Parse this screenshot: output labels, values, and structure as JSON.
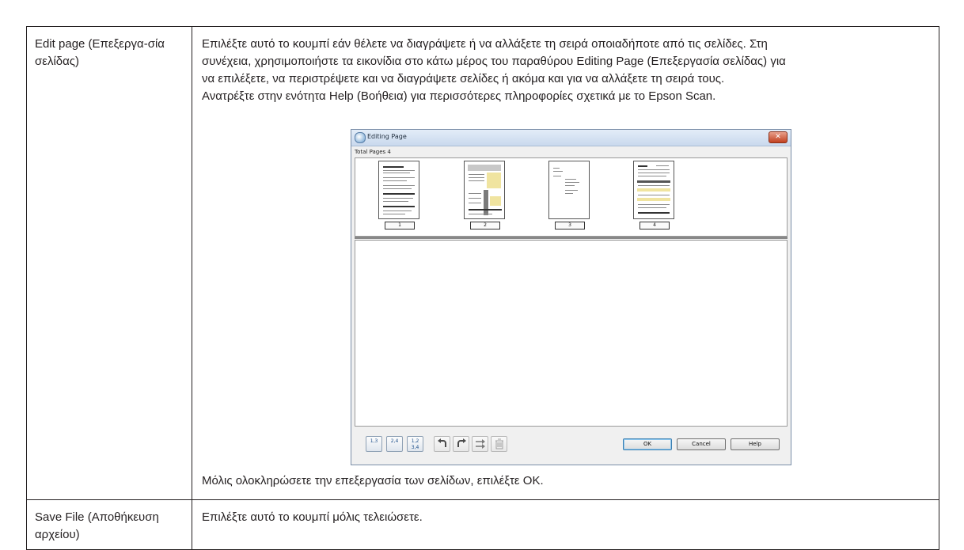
{
  "rows": [
    {
      "term": "Edit page (Επεξεργα-σία σελίδας)",
      "description_lines": [
        "Επιλέξτε αυτό το κουμπί εάν θέλετε να διαγράψετε ή να αλλάξετε τη σειρά οποιαδήποτε από τις σελίδες. Στη",
        "συνέχεια, χρησιμοποιήστε τα εικονίδια στο κάτω μέρος του παραθύρου Editing Page (Επεξεργασία σελίδας) για",
        "να επιλέξετε, να περιστρέψετε και να διαγράψετε σελίδες ή ακόμα και για να αλλάξετε τη σειρά τους.",
        "Ανατρέξτε στην ενότητα Help (Βοήθεια) για περισσότερες πληροφορίες σχετικά με το Epson Scan."
      ],
      "note": "Μόλις ολοκληρώσετε την επεξεργασία των σελίδων, επιλέξτε OK."
    },
    {
      "term": "Save File (Αποθήκευση αρχείου)",
      "description": "Επιλέξτε αυτό το κουμπί μόλις τελειώσετε."
    }
  ],
  "dialog": {
    "title": "Editing Page",
    "total_pages_label": "Total Pages 4",
    "pages": [
      "1",
      "2",
      "3",
      "4"
    ],
    "toolbar_icons": [
      "select-odd-pages-icon",
      "select-even-pages-icon",
      "select-all-pages-icon",
      "rotate-left-icon",
      "rotate-right-icon",
      "move-page-icon",
      "delete-page-icon"
    ],
    "toolbar_texts": {
      "odd": "1,3",
      "even": "2,4",
      "all": "1,2 3,4"
    },
    "buttons": {
      "ok": "OK",
      "cancel": "Cancel",
      "help": "Help"
    },
    "close_glyph": "✕",
    "colors": {
      "title_bar": "#c9d9ed",
      "close": "#c2401f",
      "frame": "#f0f0f0"
    }
  }
}
